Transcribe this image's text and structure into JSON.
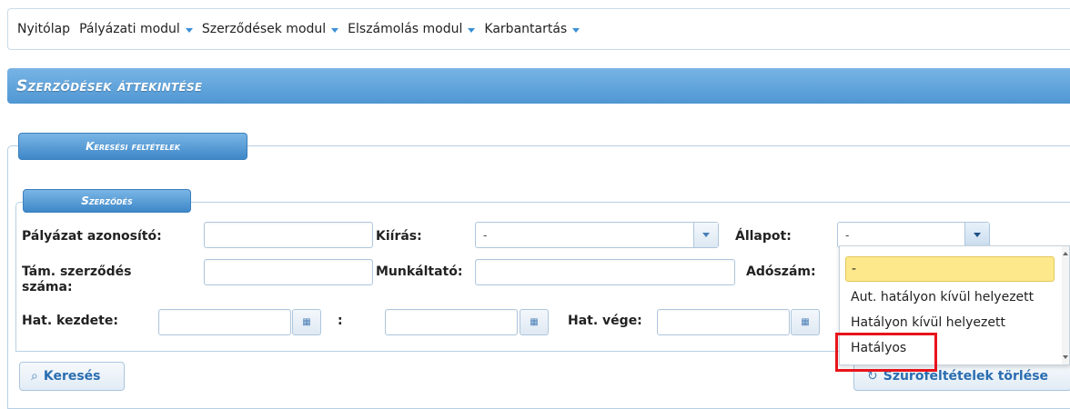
{
  "nav": {
    "items": [
      {
        "label": "Nyitólap",
        "has_menu": false
      },
      {
        "label": "Pályázati modul",
        "has_menu": true
      },
      {
        "label": "Szerződések modul",
        "has_menu": true
      },
      {
        "label": "Elszámolás modul",
        "has_menu": true
      },
      {
        "label": "Karbantartás",
        "has_menu": true
      }
    ]
  },
  "page": {
    "title": "Szerződések áttekintése"
  },
  "search_panel": {
    "legend": "Keresési feltételek"
  },
  "contract_section": {
    "legend": "Szerződés",
    "labels": {
      "palyazat_azonosito": "Pályázat azonosító:",
      "kiiras": "Kiírás:",
      "allapot": "Állapot:",
      "tam_szerzodes_szama": "Tám. szerződés száma:",
      "munkaltato": "Munkáltató:",
      "adoszam": "Adószám:",
      "hat_kezdete": "Hat. kezdete:",
      "range_sep": ":",
      "hat_vege": "Hat. vége:"
    },
    "values": {
      "kiiras": "-",
      "allapot": "-"
    }
  },
  "allapot_dropdown": {
    "options": [
      "-",
      "Aut. hatályon kívül helyezett",
      "Hatályon kívül helyezett",
      "Hatályos"
    ],
    "selected_index": 0,
    "highlighted_option": "Hatályos"
  },
  "buttons": {
    "search": "Keresés",
    "clear": "Szűrőfeltételek törlése"
  },
  "colors": {
    "accent": "#4f97d3",
    "highlight": "#e8141b",
    "selected_option": "#fde98c"
  }
}
